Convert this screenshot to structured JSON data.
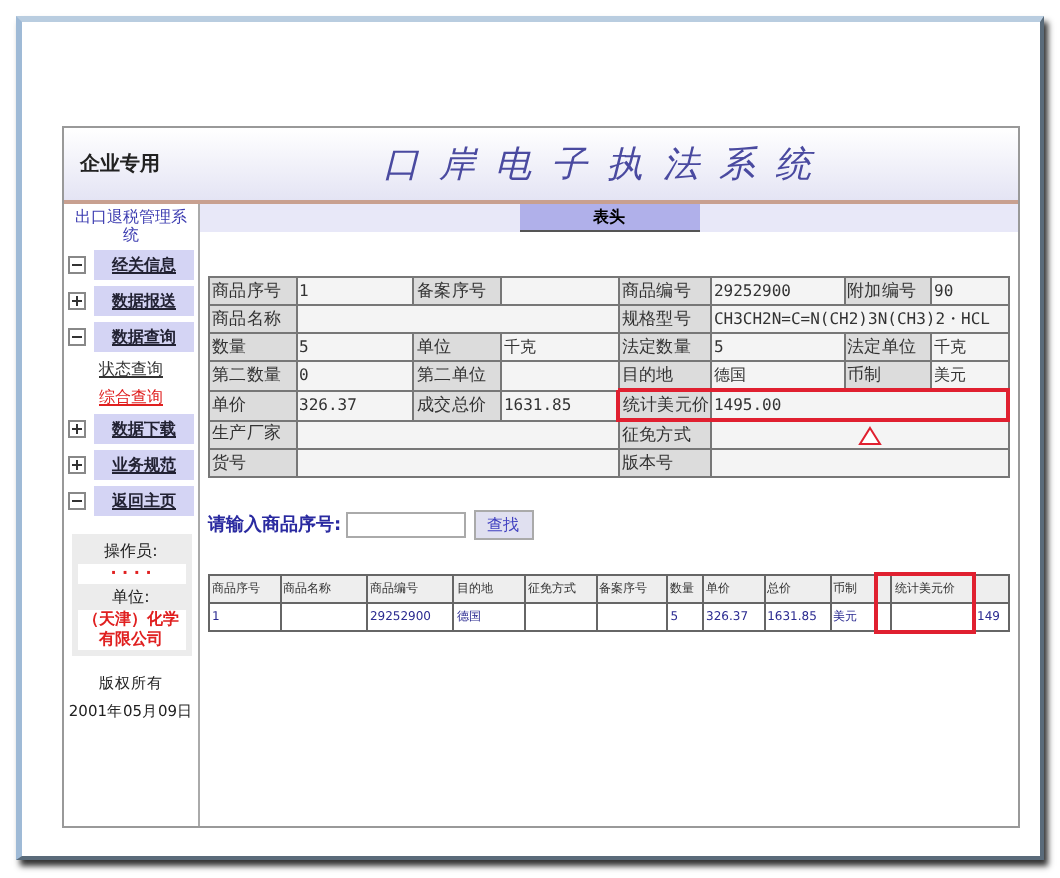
{
  "header": {
    "badge": "企业专用",
    "title": "口岸电子执法系统"
  },
  "sidebar": {
    "title": "出口退税管理系统",
    "items": [
      {
        "label": "经关信息",
        "expanded": true,
        "selected": false
      },
      {
        "label": "数据报送",
        "expanded": false,
        "selected": false
      },
      {
        "label": "数据查询",
        "expanded": true,
        "selected": false,
        "children": [
          {
            "label": "状态查询",
            "selected": false
          },
          {
            "label": "综合查询",
            "selected": true
          }
        ]
      },
      {
        "label": "数据下载",
        "expanded": false,
        "selected": false
      },
      {
        "label": "业务规范",
        "expanded": false,
        "selected": false
      },
      {
        "label": "返回主页",
        "expanded": true,
        "selected": false
      }
    ],
    "operator": {
      "label": "操作员:",
      "value": "· · · ·",
      "unit_label": "单位:",
      "unit_value": "（天津）化学有限公司"
    },
    "footer": [
      "版权所有",
      "2001年05月09日"
    ]
  },
  "section_tab": "表头",
  "form": {
    "rows": [
      [
        {
          "label": "商品序号",
          "value": "1"
        },
        {
          "label": "备案序号"
        },
        {
          "label": "商品编号",
          "value": "29252900"
        },
        {
          "label": "附加编号",
          "value": "90"
        }
      ],
      [
        {
          "label": "商品名称",
          "wide": true
        },
        {
          "label": "规格型号",
          "value": "CH3CH2N=C=N(CH2)3N(CH3)2・HCL",
          "wide": true
        }
      ],
      [
        {
          "label": "数量",
          "value": "5"
        },
        {
          "label": "单位",
          "value": "千克"
        },
        {
          "label": "法定数量",
          "value": "5"
        },
        {
          "label": "法定单位",
          "value": "千克"
        }
      ],
      [
        {
          "label": "第二数量",
          "value": "0"
        },
        {
          "label": "第二单位"
        },
        {
          "label": "目的地",
          "value": "德国"
        },
        {
          "label": "币制",
          "value": "美元"
        }
      ],
      [
        {
          "label": "单价",
          "value": "326.37"
        },
        {
          "label": "成交总价",
          "value": "1631.85"
        },
        {
          "label": "统计美元价",
          "value": "1495.00",
          "wide": true,
          "highlighted": true
        }
      ],
      [
        {
          "label": "生产厂家",
          "wide": true
        },
        {
          "label": "征免方式",
          "wide": true
        }
      ],
      [
        {
          "label": "货号",
          "wide": true
        },
        {
          "label": "版本号",
          "wide": true
        }
      ]
    ]
  },
  "search": {
    "label": "请输入商品序号:",
    "button": "查找"
  },
  "results": {
    "columns": [
      {
        "label": "商品序号",
        "highlighted": false
      },
      {
        "label": "商品名称",
        "highlighted": false
      },
      {
        "label": "商品编号",
        "highlighted": false
      },
      {
        "label": "目的地",
        "highlighted": false
      },
      {
        "label": "征免方式",
        "highlighted": false
      },
      {
        "label": "备案序号",
        "highlighted": false
      },
      {
        "label": "数量",
        "highlighted": false
      },
      {
        "label": "单价",
        "highlighted": false
      },
      {
        "label": "总价",
        "highlighted": false
      },
      {
        "label": "币制",
        "highlighted": false
      },
      {
        "highlighted": true
      },
      {
        "label": "统计美元价",
        "highlighted": true
      },
      {
        "highlighted": false
      }
    ],
    "rows": [
      [
        "1",
        "",
        "29252900",
        "德国",
        "",
        "",
        "5",
        "326.37",
        "1631.85",
        "美元",
        "",
        "",
        "149"
      ]
    ]
  }
}
